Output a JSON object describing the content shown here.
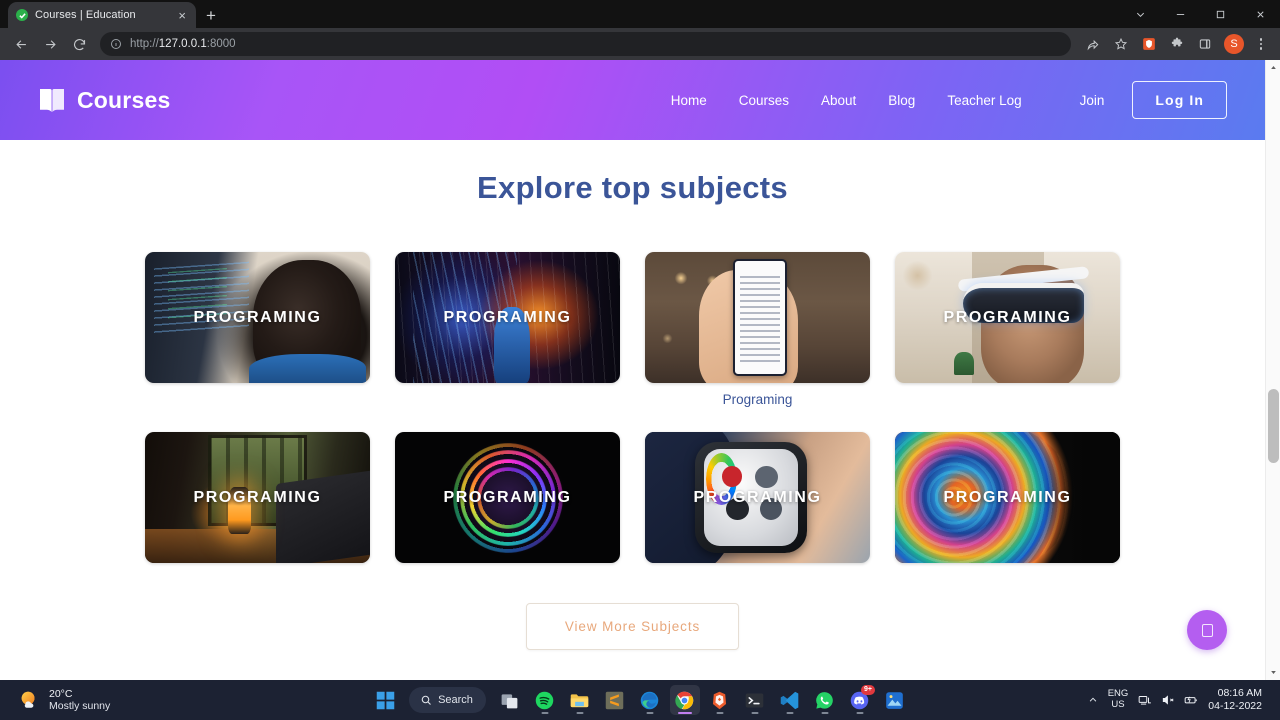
{
  "browser": {
    "tab": {
      "title": "Courses | Education",
      "favicon": "check-circle-icon",
      "close": "×"
    },
    "new_tab_label": "+",
    "window_controls": [
      "tab-search-icon",
      "minimize-icon",
      "maximize-icon",
      "close-icon"
    ],
    "nav_buttons": [
      "back-icon",
      "forward-icon",
      "reload-icon"
    ],
    "url_prefix": "http://",
    "url_host": "127.0.0.1",
    "url_port": ":8000",
    "toolbar_icons": [
      "share-icon",
      "bookmark-star-icon",
      "brave-extension-icon",
      "extensions-puzzle-icon",
      "side-panel-icon"
    ],
    "profile_initial": "S"
  },
  "site": {
    "brand": {
      "icon": "open-book-icon",
      "name": "Courses"
    },
    "nav": [
      {
        "label": "Home"
      },
      {
        "label": "Courses"
      },
      {
        "label": "About"
      },
      {
        "label": "Blog"
      },
      {
        "label": "Teacher Log"
      },
      {
        "label": "Join"
      }
    ],
    "login_button": "Log In",
    "section_title": "Explore top subjects",
    "cards": [
      {
        "label": "PROGRAMING",
        "caption": "",
        "art": "art-code"
      },
      {
        "label": "PROGRAMING",
        "caption": "",
        "art": "art-neon"
      },
      {
        "label": "",
        "caption": "Programing",
        "art": "art-phone"
      },
      {
        "label": "PROGRAMING",
        "caption": "",
        "art": "art-vr"
      },
      {
        "label": "PROGRAMING",
        "caption": "",
        "art": "art-cabin"
      },
      {
        "label": "PROGRAMING",
        "caption": "",
        "art": "art-spiral"
      },
      {
        "label": "PROGRAMING",
        "caption": "",
        "art": "art-watch"
      },
      {
        "label": "PROGRAMING",
        "caption": "",
        "art": "art-marble"
      }
    ],
    "view_more_button": "View More Subjects",
    "fab": "chat-widget-button",
    "colors": {
      "header_gradient_start": "#7b4ff0",
      "header_gradient_mid": "#b14ef5",
      "header_gradient_end": "#5a7bf0",
      "heading": "#3b5598",
      "more_button_text": "#e8a87c",
      "fab": "#b45ef0"
    }
  },
  "taskbar": {
    "weather": {
      "temperature": "20°C",
      "description": "Mostly sunny",
      "icon": "sun-cloud-icon"
    },
    "items": [
      {
        "name": "start-button",
        "icon": "windows-logo-icon"
      },
      {
        "name": "search",
        "icon": "search-icon",
        "label": "Search"
      },
      {
        "name": "task-view",
        "icon": "task-view-icon"
      },
      {
        "name": "spotify",
        "icon": "spotify-icon"
      },
      {
        "name": "file-explorer",
        "icon": "folder-icon"
      },
      {
        "name": "sublime-text",
        "icon": "sublime-text-icon"
      },
      {
        "name": "microsoft-edge",
        "icon": "edge-icon"
      },
      {
        "name": "google-chrome",
        "icon": "chrome-icon"
      },
      {
        "name": "brave-browser",
        "icon": "brave-icon"
      },
      {
        "name": "terminal",
        "icon": "terminal-icon"
      },
      {
        "name": "visual-studio-code",
        "icon": "vscode-icon"
      },
      {
        "name": "whatsapp",
        "icon": "whatsapp-icon"
      },
      {
        "name": "discord",
        "icon": "discord-icon",
        "badge": "9+"
      },
      {
        "name": "photos",
        "icon": "photos-icon"
      }
    ],
    "tray": {
      "chevron": "chevron-up-icon",
      "language": "ENG",
      "region": "US",
      "icons": [
        "network-icon",
        "volume-muted-icon",
        "battery-icon"
      ],
      "time": "08:16 AM",
      "date": "04-12-2022"
    }
  }
}
